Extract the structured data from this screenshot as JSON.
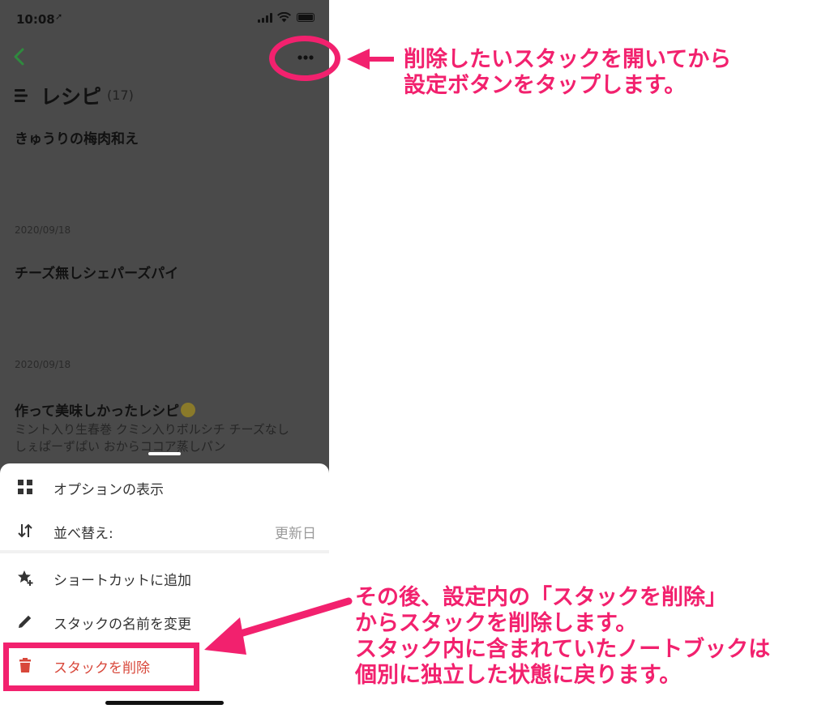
{
  "status_bar": {
    "time": "10:08",
    "location_glyph": "➚"
  },
  "header": {
    "back_icon": "chevron-left-icon",
    "more_icon": "ellipsis-icon"
  },
  "stack": {
    "title": "レシピ",
    "count": "(17)"
  },
  "notes": [
    {
      "title": "きゅうりの梅肉和え",
      "date": "2020/09/18"
    },
    {
      "title": "チーズ無しシェパーズパイ",
      "date": "2020/09/18"
    },
    {
      "title": "作って美味しかったレシピ",
      "body_line1": "ミント入り生春巻 クミン入りボルシチ チーズなし",
      "body_line2": "しぇぱーずぱい おからココア蒸しパン"
    }
  ],
  "sheet": {
    "items": [
      {
        "label": "オプションの表示",
        "icon": "grid-icon"
      },
      {
        "label": "並べ替え:",
        "value": "更新日",
        "icon": "sort-arrows-icon"
      },
      {
        "label": "ショートカットに追加",
        "icon": "star-add-icon"
      },
      {
        "label": "スタックの名前を変更",
        "icon": "pencil-icon"
      },
      {
        "label": "スタックを削除",
        "icon": "trash-icon"
      }
    ]
  },
  "annotations": {
    "callout_top": [
      "削除したいスタックを開いてから",
      "設定ボタンをタップします。"
    ],
    "callout_bottom": [
      "その後、設定内の「スタックを削除」",
      "からスタックを削除します。",
      "スタック内に含まれていたノートブックは",
      "個別に独立した状態に戻ります。"
    ]
  },
  "colors": {
    "accent": "#f2216e",
    "danger": "#d8473a",
    "green": "#2f8a3e",
    "overlay": "#4a4a4a"
  }
}
